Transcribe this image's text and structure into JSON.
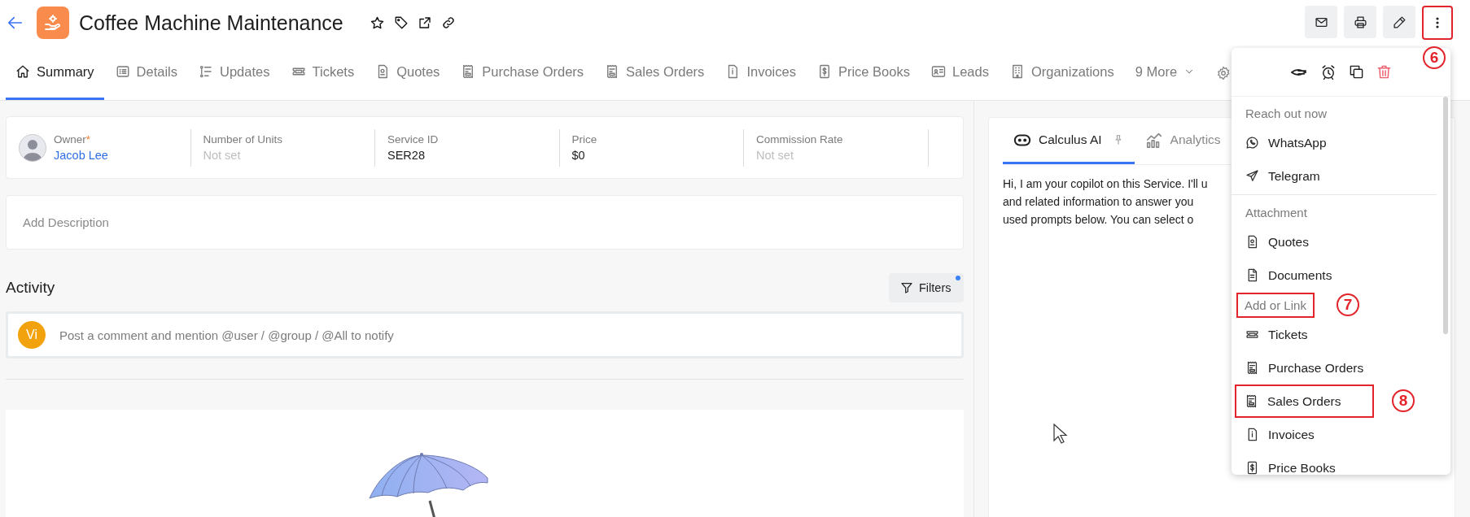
{
  "header": {
    "title": "Coffee Machine Maintenance",
    "more_button": {
      "callout": "6"
    }
  },
  "tabs": [
    {
      "label": "Summary",
      "kind": "home",
      "selected": true
    },
    {
      "label": "Details",
      "kind": "list",
      "selected": false
    },
    {
      "label": "Updates",
      "kind": "updates",
      "selected": false
    },
    {
      "label": "Tickets",
      "kind": "ticket",
      "selected": false
    },
    {
      "label": "Quotes",
      "kind": "quote",
      "selected": false
    },
    {
      "label": "Purchase Orders",
      "kind": "purchase-order",
      "selected": false
    },
    {
      "label": "Sales Orders",
      "kind": "sales-order",
      "selected": false
    },
    {
      "label": "Invoices",
      "kind": "invoice",
      "selected": false
    },
    {
      "label": "Price Books",
      "kind": "price-book",
      "selected": false
    },
    {
      "label": "Leads",
      "kind": "lead",
      "selected": false
    },
    {
      "label": "Organizations",
      "kind": "building",
      "selected": false
    },
    {
      "label": "9 More",
      "kind": "more",
      "selected": false
    }
  ],
  "fields": [
    {
      "kind": "user",
      "label": "Owner",
      "required_mark": "*",
      "value": "Jacob Lee"
    },
    {
      "kind": "text",
      "label": "Number of Units",
      "value": "Not set",
      "set": false
    },
    {
      "kind": "text",
      "label": "Service ID",
      "value": "SER28"
    },
    {
      "kind": "text",
      "label": "Price",
      "value": "$0"
    },
    {
      "kind": "text",
      "label": "Commission Rate",
      "value": "Not set",
      "set": false
    }
  ],
  "description": {
    "placeholder": "Add Description"
  },
  "activity": {
    "title": "Activity",
    "filters_button": {
      "label": "Filters",
      "active": true
    },
    "comment": {
      "avatar": "Vi",
      "placeholder": "Post a comment and mention @user / @group / @All to notify"
    }
  },
  "side_panel": {
    "tabs": [
      {
        "label": "Calculus AI",
        "kind": "ai",
        "selected": true,
        "pinned": true
      },
      {
        "label": "Analytics",
        "kind": "analytics",
        "selected": false
      }
    ],
    "message_lines": [
      "Hi, I am your copilot on this Service. I'll u",
      "and related information to answer you",
      "used prompts below. You can select o"
    ]
  },
  "actions_menu": {
    "sections": [
      {
        "title": "Reach out now",
        "divider_after": true,
        "items": [
          {
            "label": "WhatsApp",
            "kind": "whatsapp"
          },
          {
            "label": "Telegram",
            "kind": "telegram"
          }
        ]
      },
      {
        "title": "Attachment",
        "divider_after": false,
        "items": [
          {
            "label": "Quotes",
            "kind": "quote"
          },
          {
            "label": "Documents",
            "kind": "document"
          }
        ]
      },
      {
        "title": "Add or Link",
        "callout": "7",
        "divider_after": false,
        "items": [
          {
            "label": "Tickets",
            "kind": "ticket"
          },
          {
            "label": "Purchase Orders",
            "kind": "purchase-order"
          },
          {
            "label": "Sales Orders",
            "kind": "sales-order",
            "callout": "8"
          },
          {
            "label": "Invoices",
            "kind": "invoice"
          },
          {
            "label": "Price Books",
            "kind": "price-book"
          }
        ]
      }
    ]
  }
}
